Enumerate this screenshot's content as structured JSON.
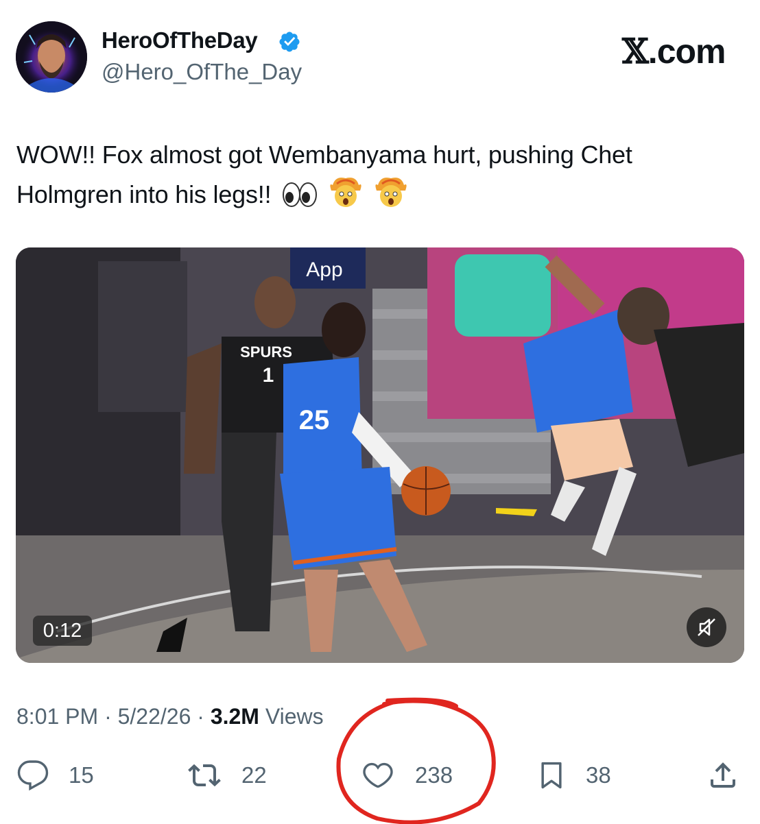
{
  "tweet": {
    "display_name": "HeroOfTheDay",
    "handle": "@Hero_OfThe_Day",
    "verified": true,
    "text_line1": "WOW!! Fox almost got Wembanyama hurt, pushing Chet",
    "text_line2": "Holmgren into his legs!!",
    "emojis": [
      "eyes",
      "exploding-head",
      "exploding-head"
    ]
  },
  "brand": {
    "x": "𝕏",
    "domain": ".com"
  },
  "media": {
    "duration": "0:12",
    "jersey_left": "SPURS",
    "jersey_left_number": "1",
    "jersey_right_number": "25",
    "banner_text": "App"
  },
  "meta": {
    "time": "8:01 PM",
    "separator": "·",
    "date": "5/22/26",
    "views_count": "3.2M",
    "views_label": "Views"
  },
  "actions": {
    "replies": "15",
    "reposts": "22",
    "likes": "238",
    "bookmarks": "38"
  },
  "colors": {
    "verified": "#1d9bf0",
    "annotation": "#e0261f",
    "muted_text": "#536471"
  }
}
